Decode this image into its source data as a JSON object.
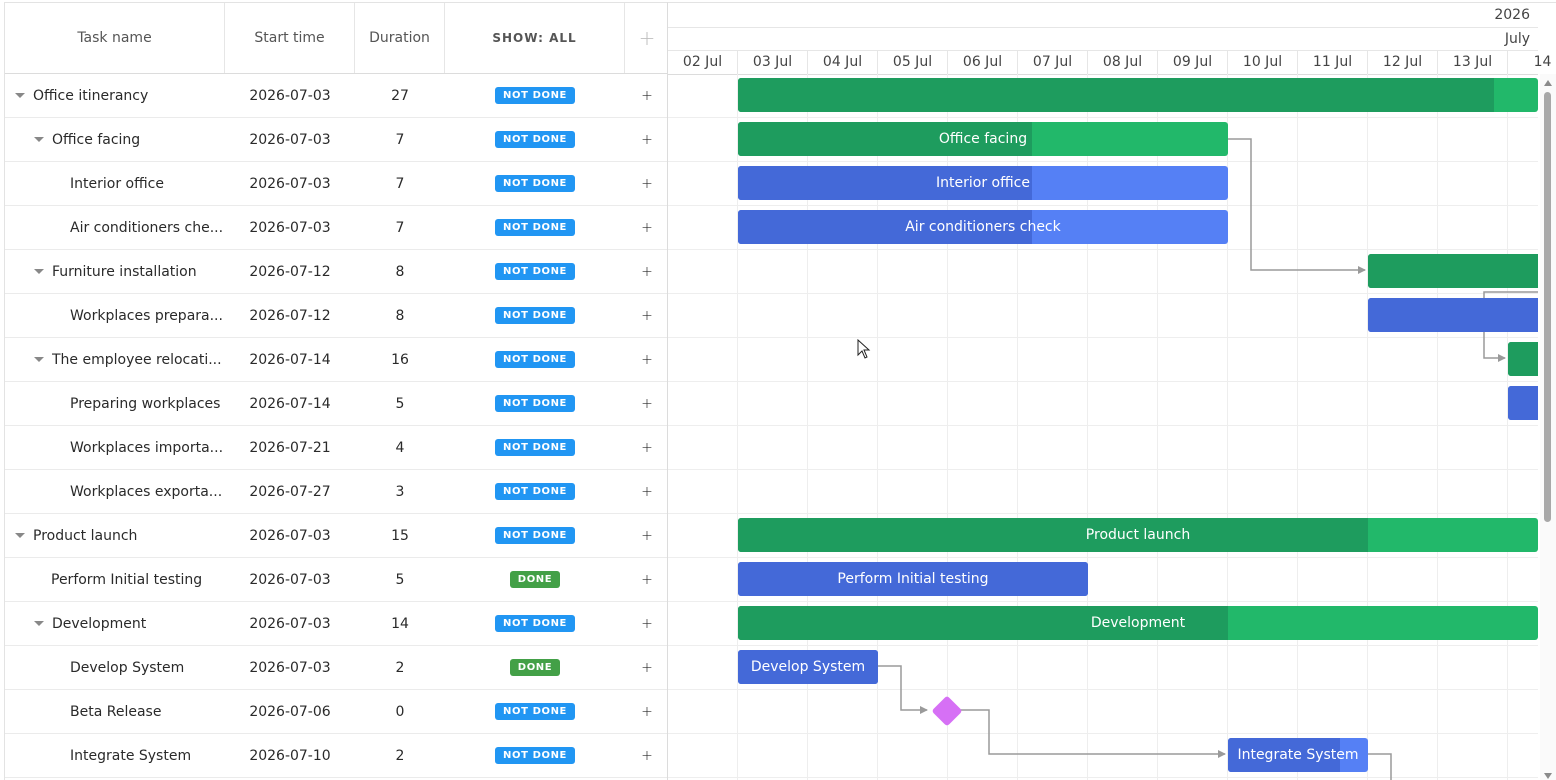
{
  "header": {
    "task_name": "Task name",
    "start_time": "Start time",
    "duration": "Duration",
    "show_all": "SHOW: ALL",
    "add": "+"
  },
  "scale": {
    "year": "2026",
    "month": "July",
    "days": [
      "02 Jul",
      "03 Jul",
      "04 Jul",
      "05 Jul",
      "06 Jul",
      "07 Jul",
      "08 Jul",
      "09 Jul",
      "10 Jul",
      "11 Jul",
      "12 Jul",
      "13 Jul",
      "14"
    ]
  },
  "tasks": [
    {
      "name": "Office itinerancy",
      "start": "2026-07-03",
      "duration": "27",
      "status": "NOT DONE",
      "level": 0,
      "parent": true
    },
    {
      "name": "Office facing",
      "start": "2026-07-03",
      "duration": "7",
      "status": "NOT DONE",
      "level": 1,
      "parent": true
    },
    {
      "name": "Interior office",
      "start": "2026-07-03",
      "duration": "7",
      "status": "NOT DONE",
      "level": 2,
      "parent": false
    },
    {
      "name": "Air conditioners che...",
      "start": "2026-07-03",
      "duration": "7",
      "status": "NOT DONE",
      "level": 2,
      "parent": false
    },
    {
      "name": "Furniture installation",
      "start": "2026-07-12",
      "duration": "8",
      "status": "NOT DONE",
      "level": 1,
      "parent": true
    },
    {
      "name": "Workplaces prepara...",
      "start": "2026-07-12",
      "duration": "8",
      "status": "NOT DONE",
      "level": 2,
      "parent": false
    },
    {
      "name": "The employee relocati...",
      "start": "2026-07-14",
      "duration": "16",
      "status": "NOT DONE",
      "level": 1,
      "parent": true
    },
    {
      "name": "Preparing workplaces",
      "start": "2026-07-14",
      "duration": "5",
      "status": "NOT DONE",
      "level": 2,
      "parent": false
    },
    {
      "name": "Workplaces importa...",
      "start": "2026-07-21",
      "duration": "4",
      "status": "NOT DONE",
      "level": 2,
      "parent": false
    },
    {
      "name": "Workplaces exporta...",
      "start": "2026-07-27",
      "duration": "3",
      "status": "NOT DONE",
      "level": 2,
      "parent": false
    },
    {
      "name": "Product launch",
      "start": "2026-07-03",
      "duration": "15",
      "status": "NOT DONE",
      "level": 0,
      "parent": true
    },
    {
      "name": "Perform Initial testing",
      "start": "2026-07-03",
      "duration": "5",
      "status": "DONE",
      "level": 1,
      "parent": false
    },
    {
      "name": "Development",
      "start": "2026-07-03",
      "duration": "14",
      "status": "NOT DONE",
      "level": 1,
      "parent": true
    },
    {
      "name": "Develop System",
      "start": "2026-07-03",
      "duration": "2",
      "status": "DONE",
      "level": 2,
      "parent": false
    },
    {
      "name": "Beta Release",
      "start": "2026-07-06",
      "duration": "0",
      "status": "NOT DONE",
      "level": 2,
      "parent": false
    },
    {
      "name": "Integrate System",
      "start": "2026-07-10",
      "duration": "2",
      "status": "NOT DONE",
      "level": 2,
      "parent": false
    }
  ],
  "bar_labels": {
    "office_facing": "Office facing",
    "interior_office": "Interior office",
    "air_conditioners": "Air conditioners check",
    "product_launch": "Product launch",
    "perform_testing": "Perform Initial testing",
    "development": "Development",
    "develop_system": "Develop System",
    "integrate_system": "Integrate System"
  },
  "colors": {
    "project_bar": "#22b86a",
    "project_progress": "#1e9c5e",
    "task_bar": "#5580f5",
    "task_progress": "#4469d8",
    "milestone": "#d670f5",
    "badge_not_done": "#2196f3",
    "badge_done": "#43a047"
  }
}
